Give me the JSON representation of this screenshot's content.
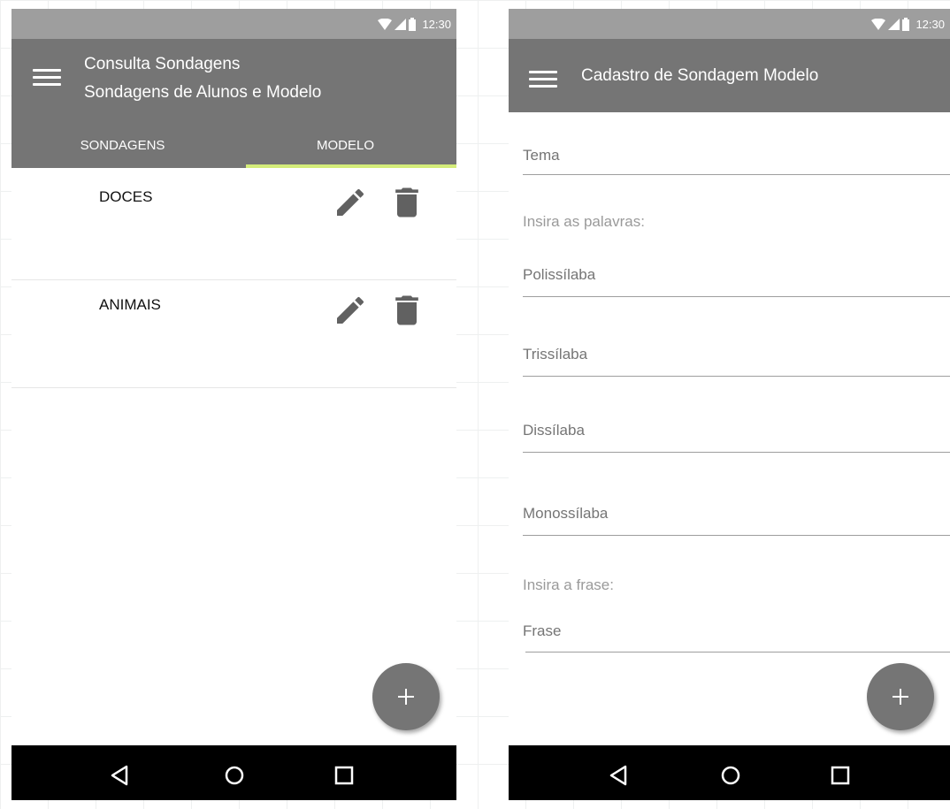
{
  "status_bar": {
    "time": "12:30",
    "icons": [
      "wifi-icon",
      "signal-icon",
      "battery-icon"
    ]
  },
  "left_screen": {
    "title": "Consulta Sondagens",
    "subtitle": "Sondagens de Alunos e Modelo",
    "tabs": [
      {
        "label": "SONDAGENS",
        "selected": false
      },
      {
        "label": "MODELO",
        "selected": true
      }
    ],
    "cards": [
      {
        "title": "DOCES",
        "actions": [
          "edit-icon",
          "delete-icon"
        ]
      },
      {
        "title": "ANIMAIS",
        "actions": [
          "edit-icon",
          "delete-icon"
        ]
      }
    ],
    "fab": "add-icon"
  },
  "right_screen": {
    "title": "Cadastro de Sondagem Modelo",
    "fields": {
      "tema": "Tema",
      "words_hint": "Insira as palavras:",
      "polissilaba": "Polissílaba",
      "trissilaba": "Trissílaba",
      "dissilaba": "Dissílaba",
      "monossilaba": "Monossílaba",
      "phrase_hint": "Insira a frase:",
      "frase": "Frase"
    },
    "fab": "add-icon"
  },
  "nav_bar": {
    "buttons": [
      "back-icon",
      "home-icon",
      "recents-icon"
    ]
  },
  "colors": {
    "status_bar": "#9e9e9e",
    "app_bar": "#757575",
    "tab_indicator": "#d4ec7a",
    "fab": "#757575",
    "icon": "#616161",
    "nav_bar": "#000000"
  }
}
